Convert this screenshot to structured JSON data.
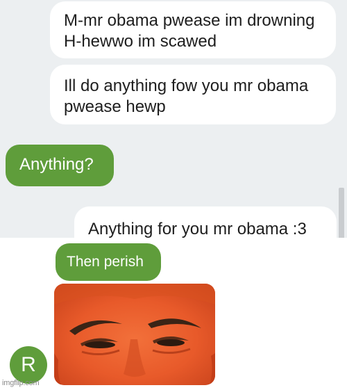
{
  "conversation": {
    "top_messages": [
      {
        "sender": "contact",
        "text": "M-mr obama pwease im drowning H-hewwo im scawed"
      },
      {
        "sender": "contact",
        "text": "Ill do anything fow you mr obama pwease hewp"
      },
      {
        "sender": "me",
        "text": "Anything?"
      },
      {
        "sender": "contact",
        "text": "Anything for you mr obama :3"
      }
    ],
    "bottom_messages": [
      {
        "sender": "me",
        "text": "Then perish"
      }
    ],
    "avatar_initial": "R",
    "photo_description_icon": "face-photo-icon"
  },
  "colors": {
    "outgoing_bubble": "#5f9d3b",
    "incoming_bubble": "#ffffff",
    "chat_background": "#eceff1"
  },
  "watermark": "imgflip.com"
}
